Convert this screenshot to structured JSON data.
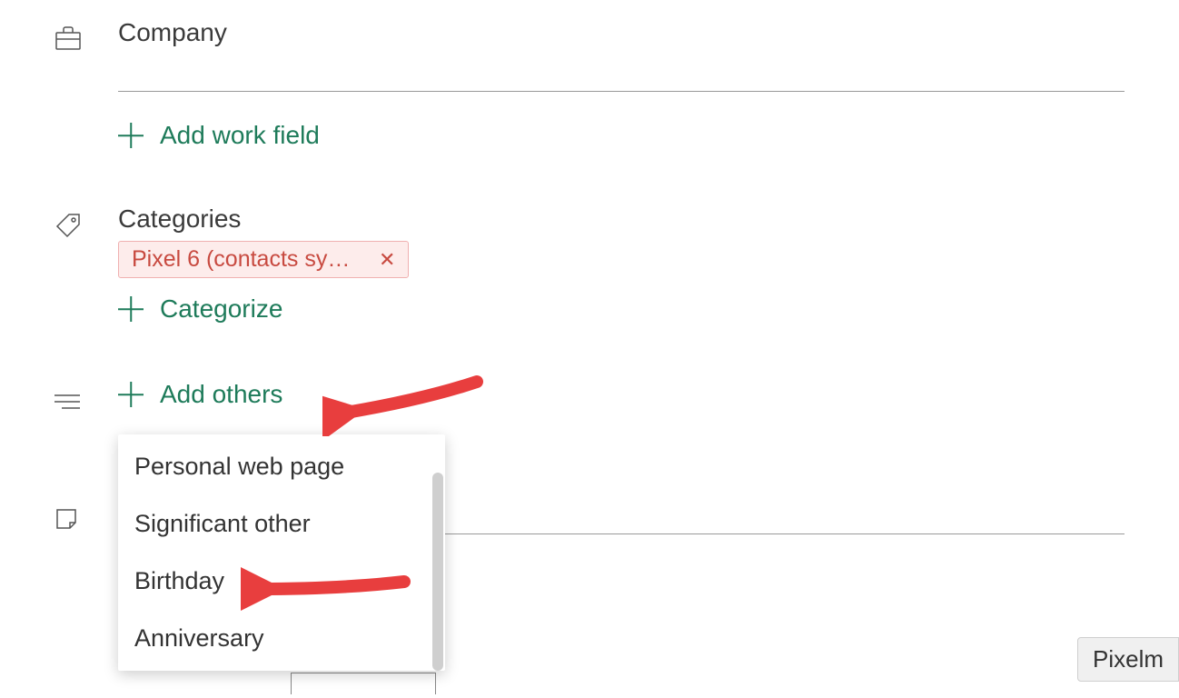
{
  "company": {
    "label": "Company",
    "value": "",
    "add_work_field_label": "Add work field"
  },
  "categories": {
    "label": "Categories",
    "chips": [
      {
        "label": "Pixel 6 (contacts syn…"
      }
    ],
    "categorize_label": "Categorize"
  },
  "others": {
    "add_others_label": "Add others",
    "dropdown": [
      "Personal web page",
      "Significant other",
      "Birthday",
      "Anniversary"
    ]
  },
  "badge": {
    "label": "Pixelm"
  },
  "colors": {
    "accent": "#1e7b5a",
    "chip_border": "#f0b0b0",
    "chip_bg": "#fdeceb",
    "chip_text": "#c84a40",
    "arrow": "#e83e3e"
  }
}
